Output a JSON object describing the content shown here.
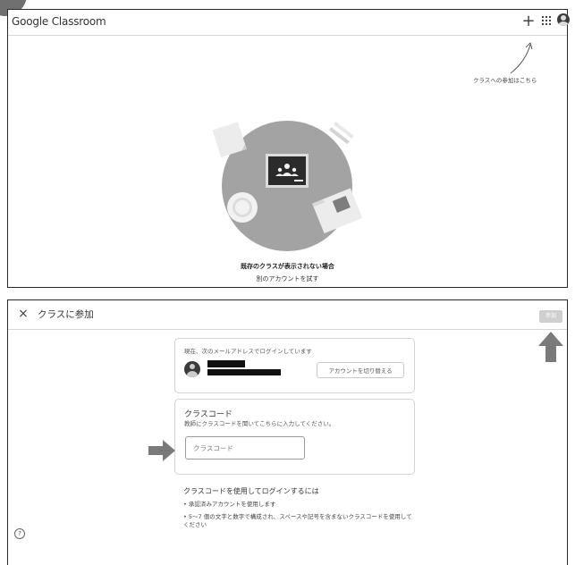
{
  "panel1": {
    "brand": "Google Classroom",
    "icons": {
      "add": "plus-icon",
      "apps": "apps-grid-icon",
      "account": "avatar-icon"
    },
    "add_glyph": "+",
    "join_hint": "クラスへの参加はこちら",
    "no_classes_text": "既存のクラスが表示されない場合",
    "other_account_link": "別のアカウントを試す"
  },
  "panel2": {
    "close_glyph": "×",
    "title": "クラスに参加",
    "join_button": "参加",
    "account_card": {
      "signed_in_text": "現在、次のメールアドレスでログインしています",
      "switch_button": "アカウントを切り替える"
    },
    "code_card": {
      "title": "クラスコード",
      "description": "教師にクラスコードを聞いてこちらに入力してください。",
      "input_placeholder": "クラスコード",
      "input_value": ""
    },
    "requirements": {
      "title": "クラスコードを使用してログインするには",
      "items": [
        "• 承認済みアカウントを使用します",
        "• 5〜7 個の文字と数字で構成され、スペースや記号を含まないクラスコードを使用してください"
      ]
    },
    "help_glyph": "?"
  },
  "colors": {
    "illustration_circle": "#a3a3a3",
    "arrow_gray": "#7a7a7a",
    "join_disabled": "#cfcfcf"
  }
}
